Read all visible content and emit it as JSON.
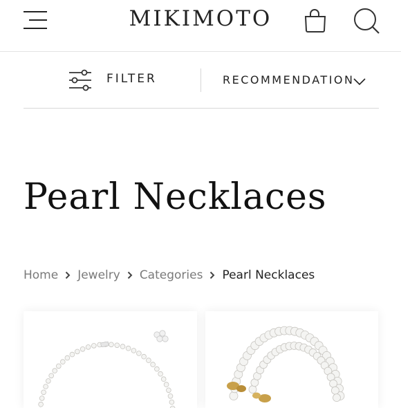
{
  "header": {
    "brand": "MIKIMOTO",
    "menu_icon": "hamburger-menu-icon",
    "cart_icon": "shopping-bag-icon",
    "search_icon": "search-icon"
  },
  "toolbar": {
    "filter_label": "FILTER",
    "filter_icon": "sliders-icon",
    "sort_label": "RECOMMENDATION",
    "sort_icon": "chevron-down-icon"
  },
  "page": {
    "title": "Pearl Necklaces"
  },
  "breadcrumb": {
    "items": [
      "Home",
      "Jewelry",
      "Categories"
    ],
    "current": "Pearl Necklaces",
    "separator_icon": "chevron-right-icon"
  },
  "products": [
    {
      "image": "pearl-strand-necklace-with-earrings-image"
    },
    {
      "image": "gold-clasp-pearl-necklace-image"
    }
  ],
  "colors": {
    "text": "#111111",
    "muted": "#7a7a7a",
    "divider": "#d8d8d8"
  }
}
